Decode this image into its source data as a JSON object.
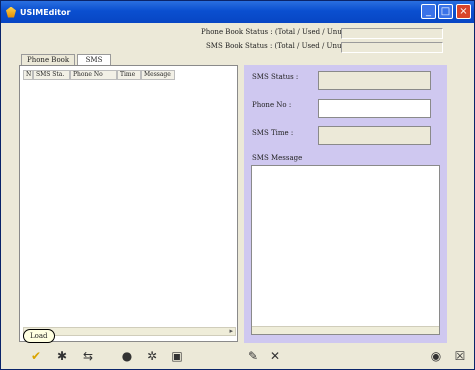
{
  "window": {
    "title": "USIMEditor"
  },
  "status": {
    "phone_book": "Phone Book Status : (Total / Used / Unused)",
    "sms_book": "SMS Book Status : (Total / Used / Unused)"
  },
  "tabs": [
    {
      "label": "Phone Book"
    },
    {
      "label": "SMS"
    }
  ],
  "sms_list": {
    "columns": [
      "N",
      "SMS Sta.",
      "Phone No",
      "Time",
      "Message"
    ]
  },
  "sms_detail": {
    "status_label": "SMS Status :",
    "phone_label": "Phone No :",
    "time_label": "SMS Time :",
    "message_label": "SMS Message"
  },
  "toolbar": {
    "tooltip": "Load",
    "icons": [
      "load-icon",
      "save-icon",
      "transfer-icon",
      "info-icon",
      "settings-icon",
      "sim-icon",
      "edit-icon",
      "delete-icon",
      "globe-icon",
      "close-icon"
    ]
  },
  "colors": {
    "titlebar": "#0a4fd0",
    "right_panel": "#cfc8f0",
    "tooltip_bg": "#ffffe1"
  }
}
